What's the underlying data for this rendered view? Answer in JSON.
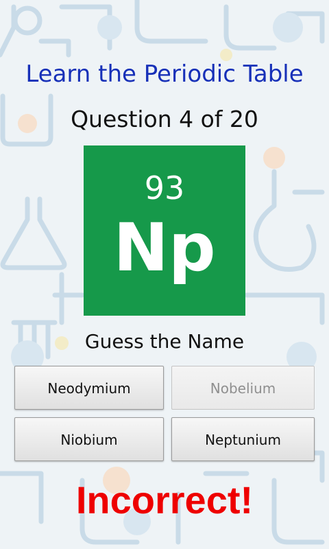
{
  "header": {
    "title": "Learn the Periodic Table",
    "question_counter": "Question 4 of 20"
  },
  "element": {
    "atomic_number": "93",
    "symbol": "Np",
    "tile_color": "#16994a"
  },
  "prompt": "Guess the Name",
  "answers": [
    {
      "label": "Neodymium",
      "state": "enabled"
    },
    {
      "label": "Nobelium",
      "state": "disabled"
    },
    {
      "label": "Niobium",
      "state": "enabled"
    },
    {
      "label": "Neptunium",
      "state": "enabled"
    }
  ],
  "result": {
    "text": "Incorrect!",
    "color": "#ee0000"
  },
  "theme": {
    "title_color": "#1730b8",
    "background_illustration": "chemistry-lab-equipment"
  }
}
